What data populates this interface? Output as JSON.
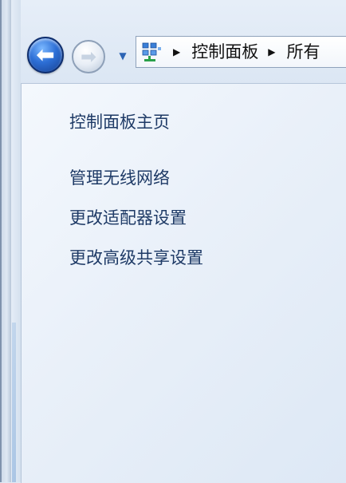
{
  "navigation": {
    "back_icon": "back-arrow-icon",
    "forward_icon": "forward-arrow-icon",
    "history_icon": "chevron-down-icon",
    "back_glyph": "⬅",
    "forward_glyph": "➡",
    "history_glyph": "▼"
  },
  "address_bar": {
    "location_icon": "control-panel-icon",
    "separator_glyph": "▶",
    "breadcrumbs": [
      {
        "label": "控制面板"
      },
      {
        "label": "所有"
      }
    ]
  },
  "sidebar": {
    "home_link": "控制面板主页",
    "tasks": [
      {
        "label": "管理无线网络"
      },
      {
        "label": "更改适配器设置"
      },
      {
        "label": "更改高级共享设置"
      }
    ]
  },
  "colors": {
    "link_text": "#1e3a66",
    "back_button": "#2d6fd6",
    "pane_background": "#eef3fa"
  }
}
